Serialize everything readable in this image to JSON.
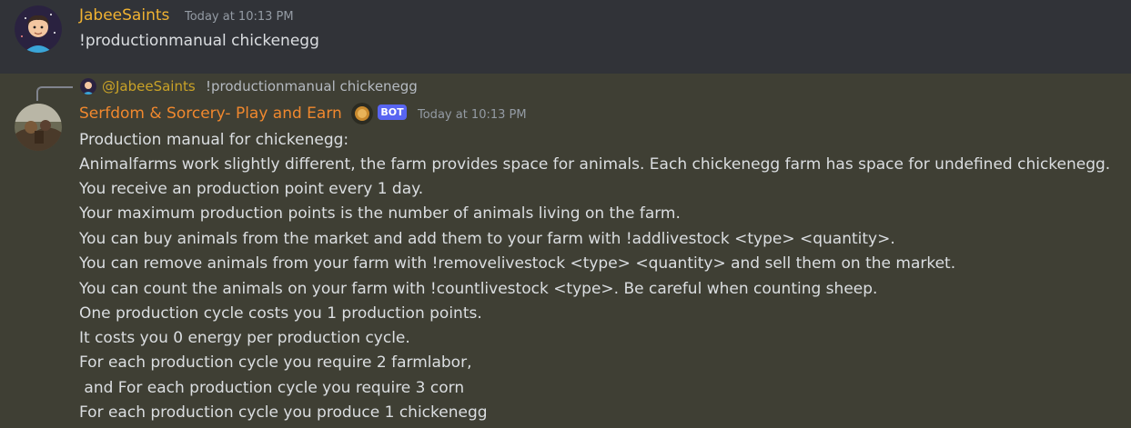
{
  "message1": {
    "username": "JabeeSaints",
    "timestamp": "Today at 10:13 PM",
    "content": "!productionmanual chickenegg",
    "username_color": "#f0b232"
  },
  "message2": {
    "reply": {
      "username": "@JabeeSaints",
      "text": "!productionmanual chickenegg"
    },
    "username": "Serfdom & Sorcery- Play and Earn",
    "username_color": "#f0882e",
    "badge": "BOT",
    "timestamp": "Today at 10:13 PM",
    "lines": [
      "Production manual for chickenegg:",
      "Animalfarms work slightly different, the farm provides space for animals. Each chickenegg farm has space for undefined chickenegg.",
      "You receive an production point every 1 day.",
      "Your maximum production points is the number of animals living on the farm.",
      "You can buy animals from the market and add them to your farm with !addlivestock <type> <quantity>.",
      "You can remove animals from your farm with !removelivestock <type> <quantity> and sell them on the market.",
      "You can count the animals on your farm with !countlivestock <type>. Be careful when counting sheep.",
      "One production cycle costs you 1 production points.",
      "It costs you 0 energy per production cycle.",
      "For each production cycle you require 2 farmlabor,",
      " and For each production cycle you require 3 corn",
      "For each production cycle you produce 1 chickenegg"
    ]
  }
}
